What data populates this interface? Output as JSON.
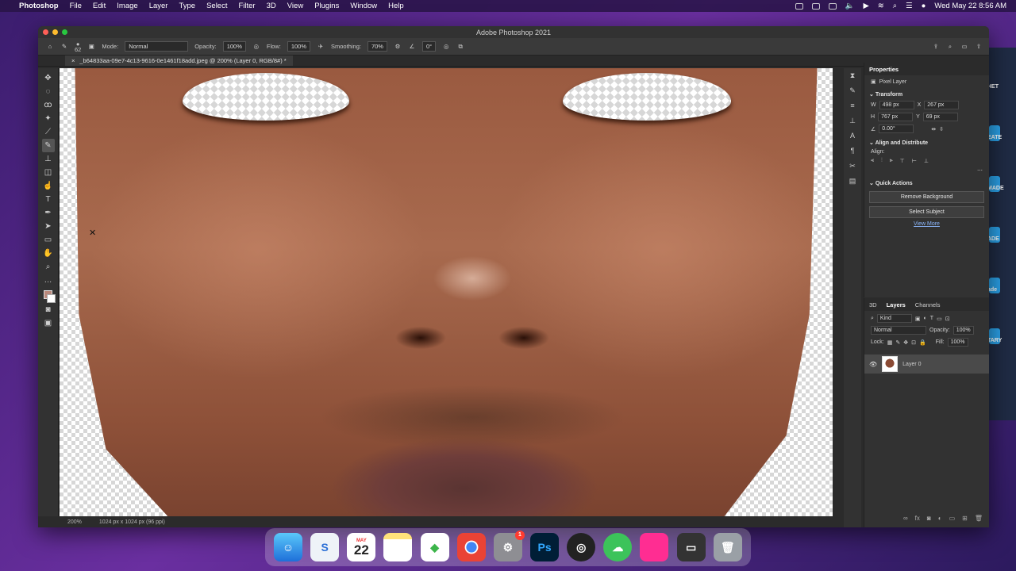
{
  "menubar": {
    "app_name": "Photoshop",
    "menus": [
      "File",
      "Edit",
      "Image",
      "Layer",
      "Type",
      "Select",
      "Filter",
      "3D",
      "View",
      "Plugins",
      "Window",
      "Help"
    ],
    "datetime": "Wed May 22  8:56 AM"
  },
  "window": {
    "title": "Adobe Photoshop 2021"
  },
  "options_bar": {
    "brush_size": "62",
    "mode_label": "Mode:",
    "mode_value": "Normal",
    "opacity_label": "Opacity:",
    "opacity_value": "100%",
    "flow_label": "Flow:",
    "flow_value": "100%",
    "smoothing_label": "Smoothing:",
    "smoothing_value": "70%",
    "angle_value": "0°"
  },
  "document": {
    "tab_title": "_b64833aa-09e7-4c13-9616-0e1461f18add.jpeg @ 200% (Layer 0, RGB/8#) *",
    "close_glyph": "×",
    "zoom": "200%",
    "doc_size": "1024 px x 1024 px (96 ppi)"
  },
  "properties": {
    "tab_label": "Properties",
    "layer_type": "Pixel Layer",
    "transform_header": "Transform",
    "w_label": "W",
    "w_value": "498 px",
    "x_label": "X",
    "x_value": "267 px",
    "h_label": "H",
    "h_value": "767 px",
    "y_label": "Y",
    "y_value": "69 px",
    "angle": "0.00°",
    "align_header": "Align and Distribute",
    "align_label": "Align:",
    "quick_actions_header": "Quick Actions",
    "remove_bg": "Remove Background",
    "select_subject": "Select Subject",
    "view_more": "View More"
  },
  "layers": {
    "tabs": [
      "3D",
      "Layers",
      "Channels"
    ],
    "kind_filter": "Kind",
    "blend_mode": "Normal",
    "opacity_label": "Opacity:",
    "opacity_value": "100%",
    "lock_label": "Lock:",
    "fill_label": "Fill:",
    "fill_value": "100%",
    "layer_name": "Layer 0"
  },
  "background_window": {
    "items": [
      "HET",
      "EATE",
      "MADE",
      "ADE",
      "ade",
      "TARY"
    ]
  },
  "dock": {
    "calendar_month": "MAY",
    "calendar_day": "22",
    "settings_badge": "1",
    "ps_label": "Ps"
  }
}
